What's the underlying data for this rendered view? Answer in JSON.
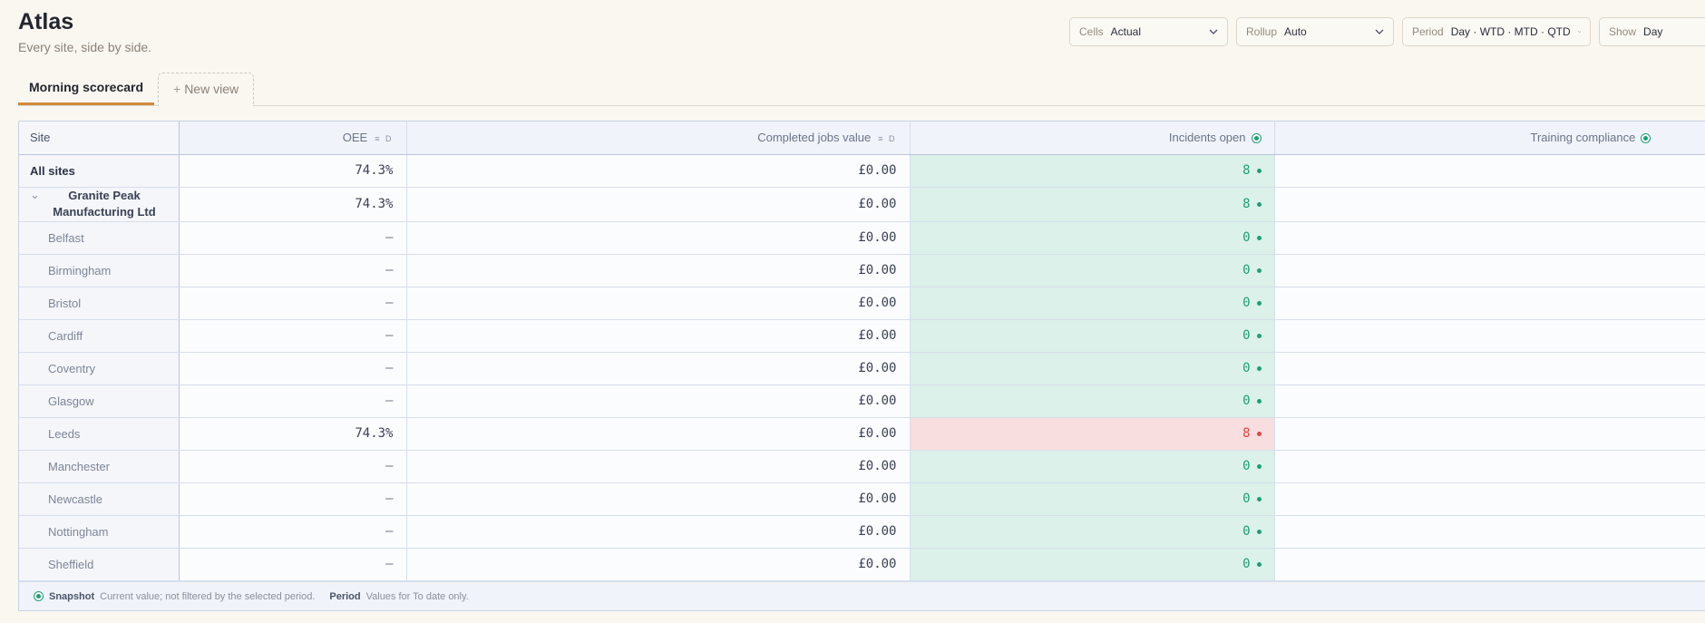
{
  "app": {
    "title": "Atlas",
    "subtitle": "Every site, side by side."
  },
  "filters": [
    {
      "label": "Cells",
      "value": "Actual"
    },
    {
      "label": "Rollup",
      "value": "Auto"
    },
    {
      "label": "Period",
      "value": "Day · WTD · MTD · QTD"
    },
    {
      "label": "Show",
      "value": "Day"
    }
  ],
  "tabs": {
    "active": "Morning scorecard",
    "new_view": "New view"
  },
  "columns": {
    "site": "Site",
    "oee": "OEE",
    "jobs": "Completed jobs value",
    "incidents": "Incidents open",
    "training": "Training compliance",
    "col_icons": "≡ D"
  },
  "rows": [
    {
      "site": "All sites",
      "oee": "74.3%",
      "jobs": "£0.00",
      "incidents": "8",
      "incident_status": "ok",
      "training": "—"
    },
    {
      "site": "Granite Peak Manufacturing Ltd",
      "oee": "74.3%",
      "jobs": "£0.00",
      "incidents": "8",
      "incident_status": "ok",
      "training": "—"
    },
    {
      "site": "Belfast",
      "oee": "—",
      "jobs": "£0.00",
      "incidents": "0",
      "incident_status": "ok",
      "training": "—"
    },
    {
      "site": "Birmingham",
      "oee": "—",
      "jobs": "£0.00",
      "incidents": "0",
      "incident_status": "ok",
      "training": "—"
    },
    {
      "site": "Bristol",
      "oee": "—",
      "jobs": "£0.00",
      "incidents": "0",
      "incident_status": "ok",
      "training": "—"
    },
    {
      "site": "Cardiff",
      "oee": "—",
      "jobs": "£0.00",
      "incidents": "0",
      "incident_status": "ok",
      "training": "—"
    },
    {
      "site": "Coventry",
      "oee": "—",
      "jobs": "£0.00",
      "incidents": "0",
      "incident_status": "ok",
      "training": "—"
    },
    {
      "site": "Glasgow",
      "oee": "—",
      "jobs": "£0.00",
      "incidents": "0",
      "incident_status": "ok",
      "training": "—"
    },
    {
      "site": "Leeds",
      "oee": "74.3%",
      "jobs": "£0.00",
      "incidents": "8",
      "incident_status": "alert",
      "training": "—"
    },
    {
      "site": "Manchester",
      "oee": "—",
      "jobs": "£0.00",
      "incidents": "0",
      "incident_status": "ok",
      "training": "—"
    },
    {
      "site": "Newcastle",
      "oee": "—",
      "jobs": "£0.00",
      "incidents": "0",
      "incident_status": "ok",
      "training": "—"
    },
    {
      "site": "Nottingham",
      "oee": "—",
      "jobs": "£0.00",
      "incidents": "0",
      "incident_status": "ok",
      "training": "—"
    },
    {
      "site": "Sheffield",
      "oee": "—",
      "jobs": "£0.00",
      "incidents": "0",
      "incident_status": "ok",
      "training": "—"
    }
  ],
  "legend": {
    "snapshot_label": "Snapshot",
    "snapshot_text": "Current value; not filtered by the selected period.",
    "period_label": "Period",
    "period_text": "Values for To date only."
  },
  "colors": {
    "accent": "#d08a3c",
    "ok": "#1e9e76",
    "ok_bg": "#dbf1ea",
    "alert": "#e04545",
    "alert_bg": "#f8dede"
  }
}
